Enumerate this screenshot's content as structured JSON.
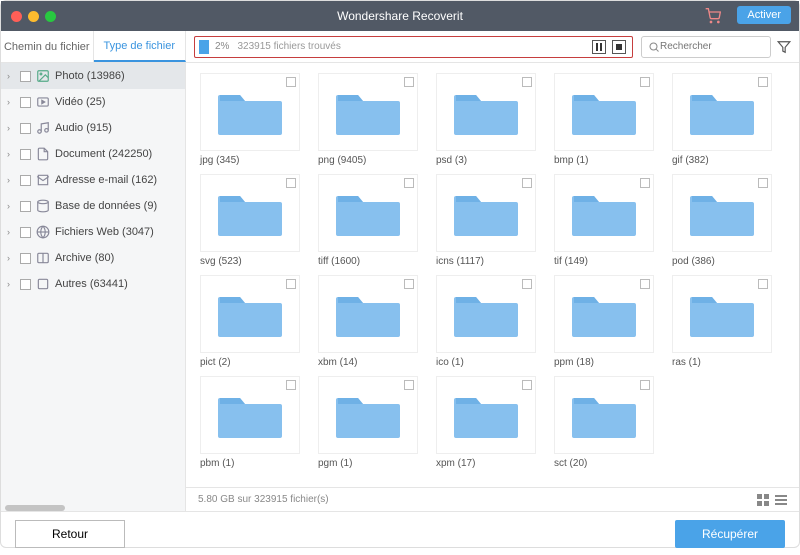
{
  "titlebar": {
    "title": "Wondershare Recoverit",
    "activate": "Activer"
  },
  "tabs": {
    "path": "Chemin du fichier",
    "type": "Type de fichier"
  },
  "progress": {
    "percent": "2%",
    "found": "323915 fichiers trouvés"
  },
  "search": {
    "placeholder": "Rechercher"
  },
  "sidebar": {
    "items": [
      {
        "label": "Photo (13986)"
      },
      {
        "label": "Vidéo (25)"
      },
      {
        "label": "Audio (915)"
      },
      {
        "label": "Document (242250)"
      },
      {
        "label": "Adresse e-mail (162)"
      },
      {
        "label": "Base de données (9)"
      },
      {
        "label": "Fichiers Web (3047)"
      },
      {
        "label": "Archive (80)"
      },
      {
        "label": "Autres (63441)"
      }
    ]
  },
  "folders": [
    [
      {
        "label": "jpg (345)"
      },
      {
        "label": "png (9405)"
      },
      {
        "label": "psd (3)"
      },
      {
        "label": "bmp (1)"
      },
      {
        "label": "gif (382)"
      }
    ],
    [
      {
        "label": "svg (523)"
      },
      {
        "label": "tiff (1600)"
      },
      {
        "label": "icns (1117)"
      },
      {
        "label": "tif (149)"
      },
      {
        "label": "pod (386)"
      }
    ],
    [
      {
        "label": "pict (2)"
      },
      {
        "label": "xbm (14)"
      },
      {
        "label": "ico (1)"
      },
      {
        "label": "ppm (18)"
      },
      {
        "label": "ras (1)"
      }
    ],
    [
      {
        "label": "pbm (1)"
      },
      {
        "label": "pgm (1)"
      },
      {
        "label": "xpm (17)"
      },
      {
        "label": "sct (20)"
      }
    ]
  ],
  "status": {
    "text": "5.80 GB sur 323915 fichier(s)"
  },
  "buttons": {
    "back": "Retour",
    "recover": "Récupérer"
  },
  "colors": {
    "accent": "#4aa3e8",
    "highlight_border": "#c63e3e",
    "folder": "#87c0ee"
  }
}
